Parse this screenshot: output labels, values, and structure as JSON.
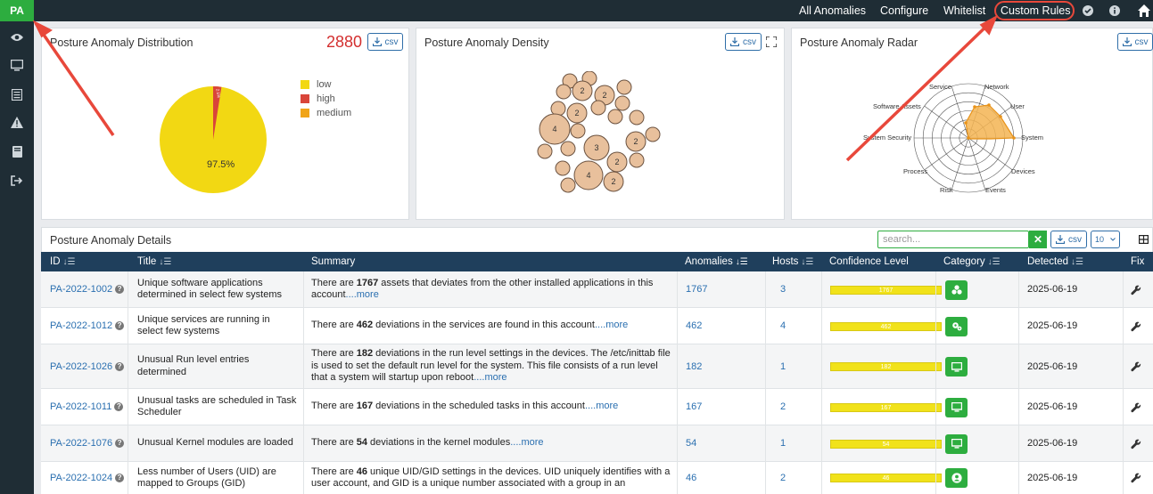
{
  "app": {
    "logo": "PA"
  },
  "sidebar": {
    "icons": [
      "eye-icon",
      "monitor-icon",
      "list-icon",
      "warning-icon",
      "book-icon",
      "logout-icon"
    ]
  },
  "topnav": {
    "links": [
      "All Anomalies",
      "Configure",
      "Whitelist",
      "Custom Rules"
    ]
  },
  "distribution": {
    "title": "Posture Anomaly Distribution",
    "count": "2880",
    "csv": "csv",
    "legend": [
      "low",
      "high",
      "medium"
    ],
    "main_label": "97.5%",
    "high_label": "2.5%",
    "colors": {
      "low": "#f2d813",
      "high": "#d9453a",
      "medium": "#f0a418"
    }
  },
  "density": {
    "title": "Posture Anomaly Density",
    "csv": "csv",
    "bubble_labels": [
      "2",
      "2",
      "2",
      "4",
      "3",
      "2",
      "2",
      "4",
      "2"
    ]
  },
  "radar": {
    "title": "Posture Anomaly Radar",
    "csv": "csv",
    "axes": [
      "Network",
      "User",
      "System",
      "Devices",
      "Events",
      "Risk",
      "Process",
      "System Security",
      "Software Assets",
      "Service"
    ]
  },
  "details": {
    "title": "Posture Anomaly Details",
    "search_placeholder": "search...",
    "csv": "csv",
    "page_size": "10",
    "columns": [
      "ID",
      "Title",
      "Summary",
      "Anomalies",
      "Hosts",
      "Confidence Level",
      "Category",
      "Detected",
      "Fix"
    ],
    "rows": [
      {
        "id": "PA-2022-1002",
        "title": "Unique software applications determined in select few systems",
        "summary_pre": "There are ",
        "summary_bold": "1767",
        "summary_post": " assets that deviates from the other installed applications in this account",
        "more": "....more",
        "anomalies": "1767",
        "hosts": "3",
        "confidence": "1767",
        "category_icon": "cubes-icon",
        "detected": "2025-06-19"
      },
      {
        "id": "PA-2022-1012",
        "title": "Unique services are running in select few systems",
        "summary_pre": "There are ",
        "summary_bold": "462",
        "summary_post": " deviations in the services are found in this account",
        "more": "....more",
        "anomalies": "462",
        "hosts": "4",
        "confidence": "462",
        "category_icon": "cogs-icon",
        "detected": "2025-06-19"
      },
      {
        "id": "PA-2022-1026",
        "title": "Unusual Run level entries determined",
        "summary_pre": "There are ",
        "summary_bold": "182",
        "summary_post": " deviations in the run level settings in the devices. The /etc/inittab file is used to set the default run level for the system. This file consists of a run level that a system will startup upon reboot",
        "more": "....more",
        "anomalies": "182",
        "hosts": "1",
        "confidence": "182",
        "category_icon": "monitor-icon",
        "detected": "2025-06-19"
      },
      {
        "id": "PA-2022-1011",
        "title": "Unusual tasks are scheduled in Task Scheduler",
        "summary_pre": "There are ",
        "summary_bold": "167",
        "summary_post": " deviations in the scheduled tasks in this account",
        "more": "....more",
        "anomalies": "167",
        "hosts": "2",
        "confidence": "167",
        "category_icon": "monitor-icon",
        "detected": "2025-06-19"
      },
      {
        "id": "PA-2022-1076",
        "title": "Unusual Kernel modules are loaded",
        "summary_pre": "There are ",
        "summary_bold": "54",
        "summary_post": " deviations in the kernel modules",
        "more": "....more",
        "anomalies": "54",
        "hosts": "1",
        "confidence": "54",
        "category_icon": "monitor-icon",
        "detected": "2025-06-19"
      },
      {
        "id": "PA-2022-1024",
        "title": "Less number of Users (UID) are mapped to Groups (GID)",
        "summary_pre": "There are ",
        "summary_bold": "46",
        "summary_post": " unique UID/GID settings in the devices. UID uniquely identifies with a user account, and GID is a unique number associated with a group in an",
        "more": "",
        "anomalies": "46",
        "hosts": "2",
        "confidence": "46",
        "category_icon": "user-icon",
        "detected": "2025-06-19"
      }
    ]
  }
}
